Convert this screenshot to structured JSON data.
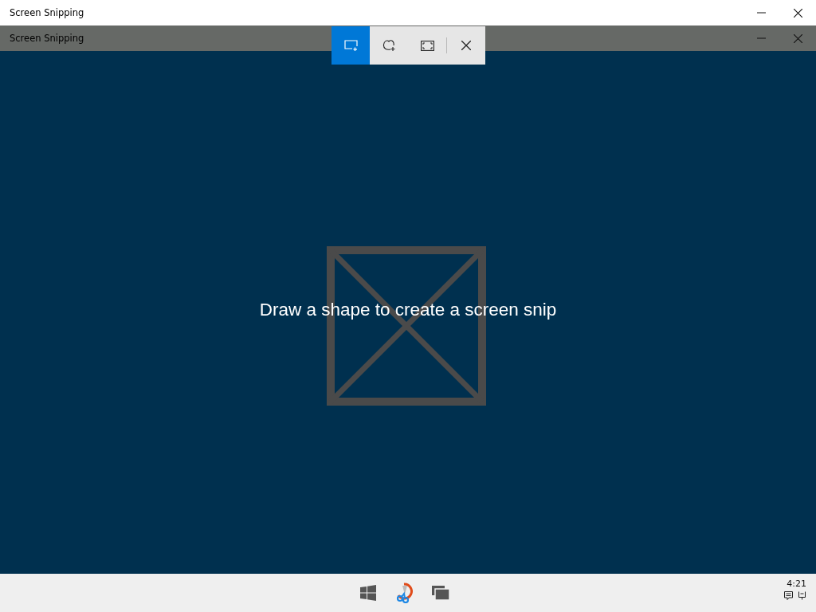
{
  "window": {
    "title": "Screen Snipping"
  },
  "overlay_window": {
    "title": "Screen Snipping"
  },
  "snip_toolbar": {
    "modes": [
      {
        "kind": "rectangle",
        "selected": true
      },
      {
        "kind": "freeform",
        "selected": false
      },
      {
        "kind": "fullscreen",
        "selected": false
      }
    ]
  },
  "canvas": {
    "message": "Draw a shape to create a screen snip"
  },
  "taskbar": {
    "clock": "4:21"
  }
}
